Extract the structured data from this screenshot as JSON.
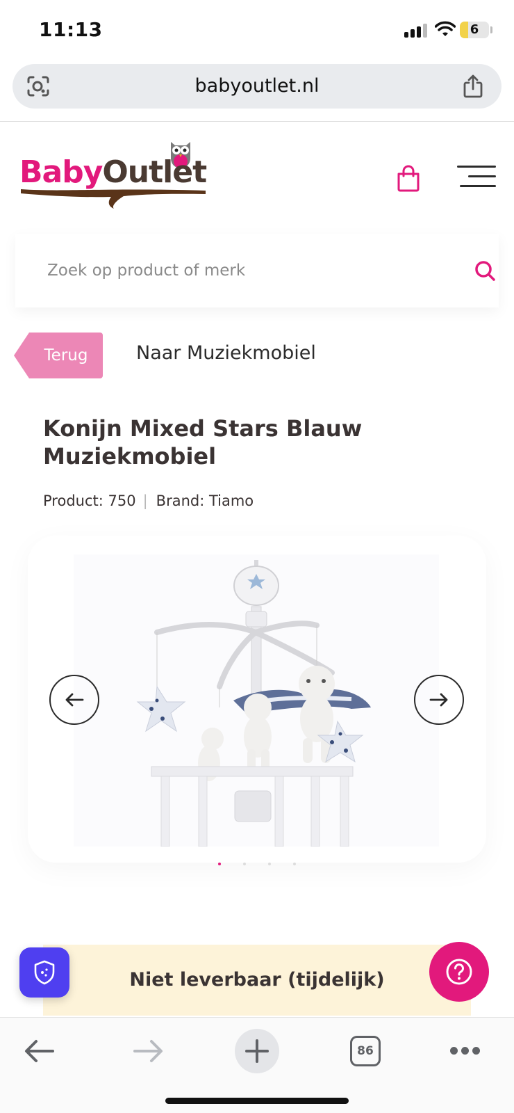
{
  "status_bar": {
    "time": "11:13",
    "battery": "6"
  },
  "browser": {
    "url": "babyoutlet.nl",
    "tabs_count": "86"
  },
  "header": {
    "logo_part1": "Baby",
    "logo_part2": "Outlet",
    "brand_color": "#e2197c"
  },
  "search": {
    "placeholder": "Zoek op product of merk"
  },
  "navigation": {
    "back_label": "Terug",
    "category_link": "Naar Muziekmobiel"
  },
  "product": {
    "title": "Konijn Mixed Stars Blauw Muziekmobiel",
    "product_label": "Product: 750",
    "brand_label": "Brand: Tiamo",
    "image_alt": "Konijn Mixed Stars Blauw Muziekmobiel"
  },
  "gallery": {
    "slide_count": 4,
    "active_index": 0
  },
  "availability": {
    "text": "Niet leverbaar (tijdelijk)",
    "background": "#fdf3d9"
  },
  "icons": {
    "lens": "lens-icon",
    "share": "share-icon",
    "bag": "bag-icon",
    "menu": "menu-icon",
    "search": "search-icon",
    "shield": "shield-icon",
    "help": "help-icon",
    "back": "arrow-left-icon",
    "forward": "arrow-right-icon",
    "new_tab": "plus-icon",
    "more": "more-icon"
  }
}
